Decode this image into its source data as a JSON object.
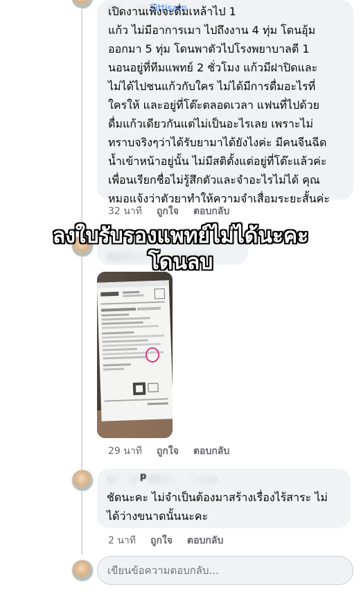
{
  "comments": [
    {
      "author_visible": "Sittisarn",
      "text": "เปิดงานเพิ่งจะดื่มเหล้าไป 1\nแก้ว ไม่มีอาการเมา ไปถึงงาน 4 ทุ่ม โดนอุ้ม\nออกมา 5 ทุ่ม โดนพาตัวไปโรงพยาบาลตี 1\nนอนอยู่ที่ทีมแพทย์ 2 ชั่วโมง แก้วมีฝาปิดและ\nไม่ได้ไปชนแก้วกับใคร ไม่ได้มีการดื่มอะไรที่\nใครให้ และอยู่ที่โต๊ะตลอดเวลา แฟนที่ไปด้วย\nดื่มแก้วเดียวกันแต่ไม่เป็นอะไรเลย เพราะไม่\nทราบจริงๆว่าได้รับยามาได้ยังไงค่ะ มีคนจีนฉีด\nน้ำเข้าหน้าอยู่นั้น ไม่มีสติตั้งแต่อยู่ที่โต๊ะแล้วค่ะ\nเพื่อนเรียกชื่อไม่รู้สึกตัวและจำอะไรไม่ได้ คุณ\nหมอแจ้งว่าตัวยาทำให้ความจำเสื่อมระยะสั้นค่ะ",
      "time": "32 นาที",
      "like": "ถูกใจ",
      "reply": "ตอบกลับ"
    },
    {
      "time": "29 นาที",
      "like": "ถูกใจ",
      "reply": "ตอบกลับ"
    },
    {
      "author_visible": "p",
      "text": "ชัดนะคะ ไม่จำเป็นต้องมาสร้างเรื่องไร้สาระ ไม่\nได้ว่างขนาดนั้นนะคะ",
      "time": "2 นาที",
      "like": "ถูกใจ",
      "reply": "ตอบกลับ"
    }
  ],
  "overlay": {
    "line1": "ลงใบรับรองแพทย์ไม่ได้นะคะ",
    "line2": "โดนลบ"
  },
  "reply_input": {
    "placeholder": "เขียนข้อความตอบกลับ..."
  },
  "colors": {
    "bubble": "#f0f2f5",
    "meta_text": "#65676b",
    "overlay_text": "#ffffff",
    "overlay_outline": "#000000",
    "pen_circle": "#e0357a"
  }
}
